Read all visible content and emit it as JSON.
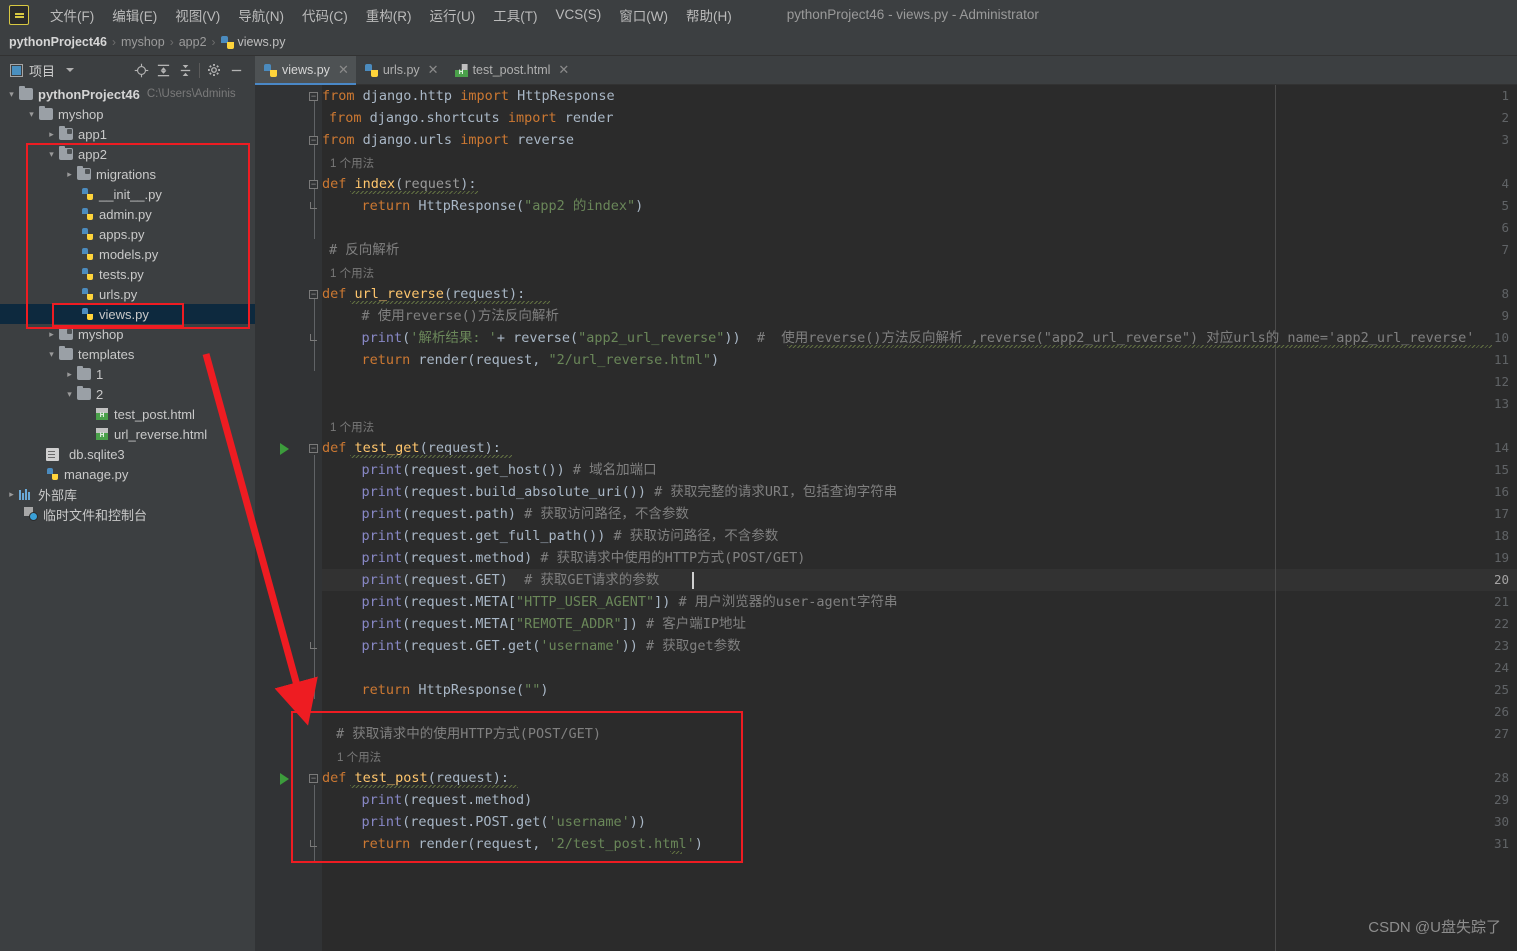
{
  "window": {
    "title": "pythonProject46 - views.py - Administrator",
    "logo": "pycharm-logo"
  },
  "menubar": [
    {
      "label": "文件(F)",
      "name": "menu-file"
    },
    {
      "label": "编辑(E)",
      "name": "menu-edit"
    },
    {
      "label": "视图(V)",
      "name": "menu-view"
    },
    {
      "label": "导航(N)",
      "name": "menu-navigate"
    },
    {
      "label": "代码(C)",
      "name": "menu-code"
    },
    {
      "label": "重构(R)",
      "name": "menu-refactor"
    },
    {
      "label": "运行(U)",
      "name": "menu-run"
    },
    {
      "label": "工具(T)",
      "name": "menu-tools"
    },
    {
      "label": "VCS(S)",
      "name": "menu-vcs"
    },
    {
      "label": "窗口(W)",
      "name": "menu-window"
    },
    {
      "label": "帮助(H)",
      "name": "menu-help"
    }
  ],
  "breadcrumb": {
    "root": "pythonProject46",
    "items": [
      "myshop",
      "app2"
    ],
    "file": "views.py",
    "separator": "›"
  },
  "project_panel": {
    "title": "项目",
    "toolbar_icons": [
      "locate-icon",
      "expand-all-icon",
      "collapse-all-icon",
      "settings-icon",
      "hide-icon"
    ]
  },
  "tree": [
    {
      "indent": 0,
      "arrow": "down",
      "icon": "folder",
      "label": "pythonProject46",
      "bold": true,
      "path": "C:\\Users\\Adminis",
      "name": "tree-item-project-root"
    },
    {
      "indent": 1,
      "arrow": "down",
      "icon": "folder",
      "label": "myshop",
      "name": "tree-item-myshop"
    },
    {
      "indent": 2,
      "arrow": "right",
      "icon": "folder-module",
      "label": "app1",
      "name": "tree-item-app1"
    },
    {
      "indent": 2,
      "arrow": "down",
      "icon": "folder-module",
      "label": "app2",
      "name": "tree-item-app2"
    },
    {
      "indent": 3,
      "arrow": "right",
      "icon": "folder-module",
      "label": "migrations",
      "name": "tree-item-migrations"
    },
    {
      "indent": 4,
      "arrow": "none",
      "icon": "python-file",
      "label": "__init__.py",
      "name": "tree-item-init-py"
    },
    {
      "indent": 4,
      "arrow": "none",
      "icon": "python-file",
      "label": "admin.py",
      "name": "tree-item-admin-py"
    },
    {
      "indent": 4,
      "arrow": "none",
      "icon": "python-file",
      "label": "apps.py",
      "name": "tree-item-apps-py"
    },
    {
      "indent": 4,
      "arrow": "none",
      "icon": "python-file",
      "label": "models.py",
      "name": "tree-item-models-py"
    },
    {
      "indent": 4,
      "arrow": "none",
      "icon": "python-file",
      "label": "tests.py",
      "name": "tree-item-tests-py"
    },
    {
      "indent": 4,
      "arrow": "none",
      "icon": "python-file",
      "label": "urls.py",
      "name": "tree-item-urls-py"
    },
    {
      "indent": 4,
      "arrow": "none",
      "icon": "python-file",
      "label": "views.py",
      "selected": true,
      "name": "tree-item-views-py"
    },
    {
      "indent": 2,
      "arrow": "right",
      "icon": "folder-module",
      "label": "myshop",
      "name": "tree-item-myshop-inner"
    },
    {
      "indent": 2,
      "arrow": "down",
      "icon": "folder",
      "label": "templates",
      "name": "tree-item-templates"
    },
    {
      "indent": 3,
      "arrow": "right",
      "icon": "folder",
      "label": "1",
      "name": "tree-item-templates-1"
    },
    {
      "indent": 3,
      "arrow": "down",
      "icon": "folder",
      "label": "2",
      "name": "tree-item-templates-2"
    },
    {
      "indent": 4,
      "arrow": "none",
      "icon": "html-file",
      "label": "test_post.html",
      "name": "tree-item-test-post-html"
    },
    {
      "indent": 4,
      "arrow": "none",
      "icon": "html-file",
      "label": "url_reverse.html",
      "name": "tree-item-url-reverse-html"
    },
    {
      "indent": 2,
      "arrow": "none",
      "icon": "db-file",
      "label": "db.sqlite3",
      "name": "tree-item-db-sqlite3"
    },
    {
      "indent": 2,
      "arrow": "none",
      "icon": "python-file",
      "label": "manage.py",
      "name": "tree-item-manage-py"
    },
    {
      "indent": 0,
      "arrow": "right",
      "icon": "library",
      "label": "外部库",
      "name": "tree-item-external-libraries"
    },
    {
      "indent": 0,
      "arrow": "none",
      "icon": "scratches",
      "label": "临时文件和控制台",
      "name": "tree-item-scratches"
    }
  ],
  "tabs": [
    {
      "label": "views.py",
      "icon": "python-file-icon",
      "active": true,
      "name": "tab-views-py"
    },
    {
      "label": "urls.py",
      "icon": "python-file-icon",
      "active": false,
      "name": "tab-urls-py"
    },
    {
      "label": "test_post.html",
      "icon": "html-file-icon",
      "active": false,
      "name": "tab-test-post-html"
    }
  ],
  "editor": {
    "filename": "views.py",
    "current_line": 20,
    "total_lines_shown": 31,
    "usage_hint": "1 个用法",
    "lines": [
      {
        "n": 1,
        "text": "from django.http import HttpResponse"
      },
      {
        "n": 2,
        "text": "from django.shortcuts import render"
      },
      {
        "n": 3,
        "text": "from django.urls import reverse"
      },
      {
        "n": null,
        "text": "1 个用法",
        "kind": "usage"
      },
      {
        "n": 4,
        "text": "def index(request):"
      },
      {
        "n": 5,
        "text": "    return HttpResponse(\"app2 的index\")"
      },
      {
        "n": 6,
        "text": ""
      },
      {
        "n": 7,
        "text": "# 反向解析"
      },
      {
        "n": null,
        "text": "1 个用法",
        "kind": "usage"
      },
      {
        "n": 8,
        "text": "def url_reverse(request):"
      },
      {
        "n": 9,
        "text": "    # 使用reverse()方法反向解析"
      },
      {
        "n": 10,
        "text": "    print('解析结果: '+ reverse(\"app2_url_reverse\"))  #  使用reverse()方法反向解析 ,reverse(\"app2_url_reverse\") 对应urls的 name='app2_url_reverse'"
      },
      {
        "n": 11,
        "text": "    return render(request, \"2/url_reverse.html\")"
      },
      {
        "n": 12,
        "text": ""
      },
      {
        "n": 13,
        "text": ""
      },
      {
        "n": null,
        "text": "1 个用法",
        "kind": "usage"
      },
      {
        "n": 14,
        "text": "def test_get(request):"
      },
      {
        "n": 15,
        "text": "    print(request.get_host()) # 域名加端口"
      },
      {
        "n": 16,
        "text": "    print(request.build_absolute_uri()) # 获取完整的请求URI，包括查询字符串"
      },
      {
        "n": 17,
        "text": "    print(request.path) # 获取访问路径，不含参数"
      },
      {
        "n": 18,
        "text": "    print(request.get_full_path()) # 获取访问路径，不含参数"
      },
      {
        "n": 19,
        "text": "    print(request.method) # 获取请求中使用的HTTP方式(POST/GET)"
      },
      {
        "n": 20,
        "text": "    print(request.GET)  # 获取GET请求的参数"
      },
      {
        "n": 21,
        "text": "    print(request.META[\"HTTP_USER_AGENT\"]) # 用户浏览器的user-agent字符串"
      },
      {
        "n": 22,
        "text": "    print(request.META[\"REMOTE_ADDR\"]) # 客户端IP地址"
      },
      {
        "n": 23,
        "text": "    print(request.GET.get('username')) # 获取get参数"
      },
      {
        "n": 24,
        "text": ""
      },
      {
        "n": 25,
        "text": "    return HttpResponse(\"\")"
      },
      {
        "n": 26,
        "text": ""
      },
      {
        "n": 27,
        "text": "# 获取请求中的使用HTTP方式(POST/GET)"
      },
      {
        "n": null,
        "text": "1 个用法",
        "kind": "usage"
      },
      {
        "n": 28,
        "text": "def test_post(request):"
      },
      {
        "n": 29,
        "text": "    print(request.method)"
      },
      {
        "n": 30,
        "text": "    print(request.POST.get('username'))"
      },
      {
        "n": 31,
        "text": "    return render(request, '2/test_post.html')"
      }
    ]
  },
  "annotations": {
    "highlight_color": "#ee1c22",
    "boxes": [
      {
        "name": "annotation-box-app2-tree",
        "note": "app2 package in project tree"
      },
      {
        "name": "annotation-box-views-py",
        "note": "views.py file selected"
      },
      {
        "name": "annotation-box-test-post",
        "note": "test_post view function"
      }
    ],
    "arrow": {
      "name": "annotation-arrow",
      "note": "points from views.py to test_post function"
    }
  },
  "watermark": "CSDN @U盘失踪了"
}
